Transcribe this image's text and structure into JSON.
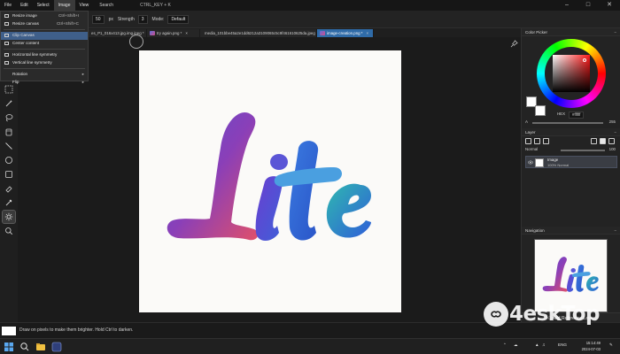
{
  "app": {
    "menu": [
      "File",
      "Edit",
      "Select",
      "Image",
      "View"
    ],
    "active_menu": "Image",
    "search_label": "Search",
    "shortcut_hint": "CTRL_KEY + K",
    "window_controls": [
      "minimize-icon",
      "maximize-icon",
      "close-icon"
    ]
  },
  "image_menu": {
    "items": [
      {
        "label": "Resize image",
        "shortcut": "Ctrl+Shift+I"
      },
      {
        "label": "Resize canvas",
        "shortcut": "Ctrl+Shift+C"
      },
      {
        "label": "Clip Canvas",
        "highlighted": true
      },
      {
        "label": "Center content"
      },
      {
        "label": "Horizontal line symmetry"
      },
      {
        "label": "Vertical line symmetry"
      },
      {
        "label": "Rotation",
        "submenu": true
      },
      {
        "label": "Flip",
        "submenu": true
      }
    ]
  },
  "options_bar": {
    "size_value": "50",
    "size_unit": "px",
    "strength_label": "Strength",
    "strength_value": "3",
    "mode_label": "Mode:",
    "mode_value": "Default"
  },
  "tabs": [
    {
      "label": "es_P1_016x413.jpg.img.jpeg *",
      "active": false
    },
    {
      "label": "try again.png *",
      "active": false
    },
    {
      "label": "media_101bbe45a2e1dd6212a3109065c5c9f461610625da.jpeg *",
      "active": false
    },
    {
      "label": "image-creation.png *",
      "active": true
    }
  ],
  "tools": [
    "select-rect-icon",
    "magic-wand-icon",
    "lasso-icon",
    "bucket-icon",
    "line-icon",
    "ellipse-icon",
    "rectangle-icon",
    "eraser-icon",
    "eyedropper-icon",
    "dodge-icon",
    "zoom-icon"
  ],
  "active_tool": "dodge-icon",
  "color_picker": {
    "title": "Color Picker",
    "hex_mode": "HEX",
    "hex_value": "#ffffff",
    "alpha_label": "A",
    "alpha_value": "255",
    "tabs": [
      "Color P...",
      "Color Sl...",
      "Palette",
      "Swatches"
    ]
  },
  "layers": {
    "title": "Layer",
    "blend_mode": "Normal",
    "opacity": "100",
    "items": [
      {
        "name": "Image",
        "detail": "100% Normal"
      }
    ],
    "add_reference_label": "Add Reference Layer"
  },
  "navigator": {
    "title": "Navigation"
  },
  "status": {
    "hint": "Draw on pixels to make them brighter. Hold Ctrl to darken."
  },
  "taskbar": {
    "lang": "ENG",
    "time": "15:14:49",
    "date": "2024-07-03"
  },
  "artwork": {
    "word": "Lite"
  },
  "watermark": {
    "text": "4eskTop"
  }
}
